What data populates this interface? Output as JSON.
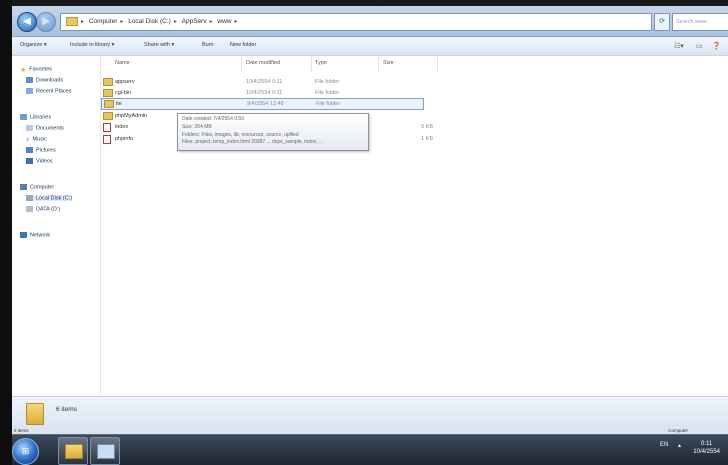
{
  "address_bar": {
    "crumbs": [
      "Computer",
      "Local Disk (C:)",
      "AppServ",
      "www"
    ],
    "search_placeholder": "Search www"
  },
  "toolbar": {
    "organize": "Organize ▾",
    "include": "Include in library ▾",
    "share": "Share with ▾",
    "burn": "Burn",
    "new_folder": "New folder"
  },
  "sidebar": {
    "favorites": "Favorites",
    "downloads": "Downloads",
    "recent": "Recent Places",
    "libraries": "Libraries",
    "documents": "Documents",
    "music": "Music",
    "pictures": "Pictures",
    "videos": "Videos",
    "computer": "Computer",
    "local_disk": "Local Disk (C:)",
    "data": "DATA (D:)",
    "network": "Network"
  },
  "columns": {
    "name": "Name",
    "date": "Date modified",
    "type": "Type",
    "size": "Size"
  },
  "files": [
    {
      "name": "appserv",
      "date": "10/4/2554 0:11",
      "type": "File folder",
      "size": "",
      "kind": "folder"
    },
    {
      "name": "cgi-bin",
      "date": "10/4/2554 0:11",
      "type": "File folder",
      "size": "",
      "kind": "folder"
    },
    {
      "name": "ite",
      "date": "9/4/2554 12:48",
      "type": "File folder",
      "size": "",
      "kind": "folder"
    },
    {
      "name": "phpMyAdmin",
      "date": "",
      "type": "",
      "size": "",
      "kind": "folder"
    },
    {
      "name": "index",
      "date": "",
      "type": "",
      "size": "5 KB",
      "kind": "html"
    },
    {
      "name": "phpinfo",
      "date": "",
      "type": "",
      "size": "1 KB",
      "kind": "html"
    }
  ],
  "tooltip": {
    "line1": "Date created: 7/4/2554 0:50",
    "line2": "Size: 264 MB",
    "line3": "Folders: Files, images, lib, resources, source, upfiled",
    "line4": "Files: project, temp_index.html 20287..., days_sample, index, ..."
  },
  "details": {
    "count": "6 items"
  },
  "status": {
    "left": "6 items",
    "right": "Computer"
  },
  "taskbar": {
    "lang": "EN",
    "time": "0:11",
    "date": "10/4/2554"
  }
}
